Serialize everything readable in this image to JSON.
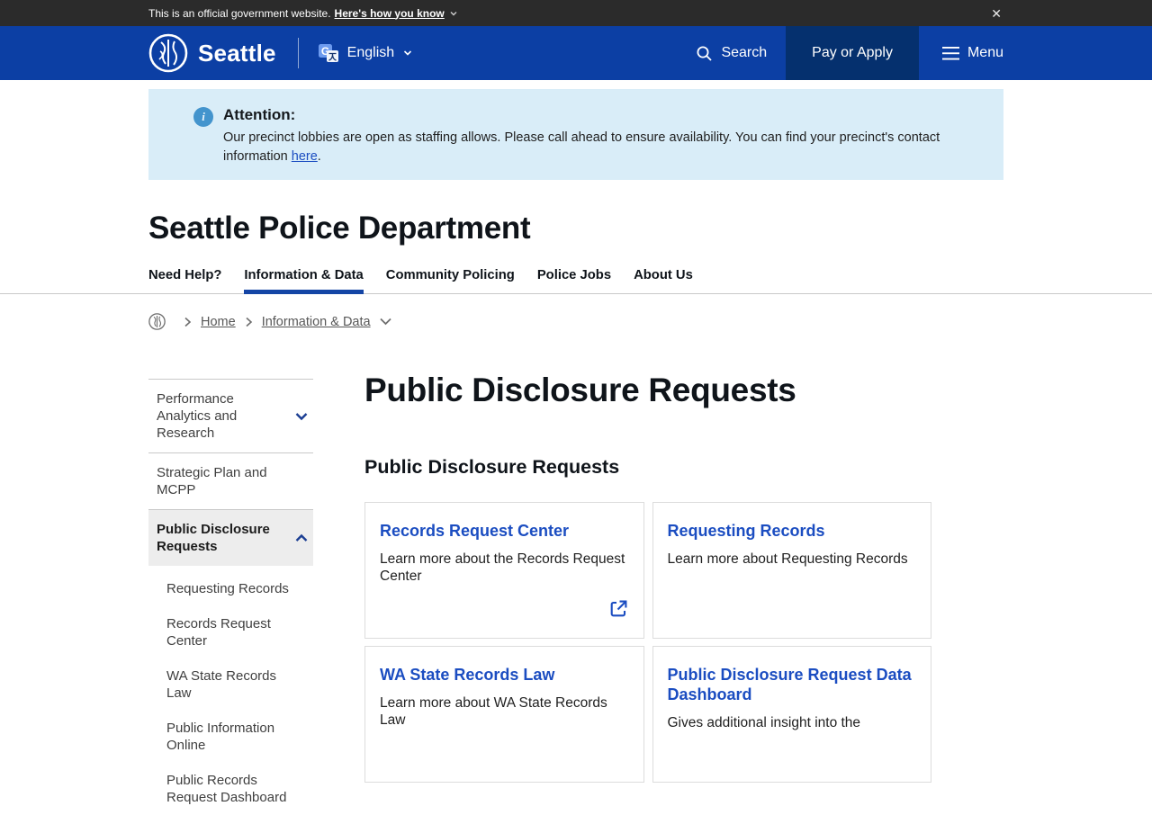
{
  "official_banner": {
    "text": "This is an official government website.",
    "link_text": "Here's how you know",
    "close_label": "✕"
  },
  "header": {
    "brand": "Seattle",
    "language": "English",
    "search_label": "Search",
    "pay_label": "Pay or Apply",
    "menu_label": "Menu",
    "colors": {
      "header_blue": "#0c3fa4",
      "pay_bg": "#05306e"
    }
  },
  "alert": {
    "title": "Attention:",
    "body": "Our precinct lobbies are open as staffing allows. Please call ahead to ensure availability. You can find your precinct's contact information ",
    "link_text": "here",
    "after_link": "."
  },
  "site": {
    "title": "Seattle Police Department"
  },
  "nav": {
    "items": [
      {
        "label": "Need Help?",
        "active": false
      },
      {
        "label": "Information & Data",
        "active": true
      },
      {
        "label": "Community Policing",
        "active": false
      },
      {
        "label": "Police Jobs",
        "active": false
      },
      {
        "label": "About Us",
        "active": false
      }
    ]
  },
  "breadcrumb": {
    "home": "Home",
    "section": "Information & Data"
  },
  "sidebar": {
    "items": [
      {
        "label": "Performance Analytics and Research",
        "chevron": "down"
      },
      {
        "label": "Strategic Plan and MCPP",
        "chevron": "none"
      },
      {
        "label": "Public Disclosure Requests",
        "chevron": "up",
        "active": true
      }
    ],
    "sub": [
      {
        "label": "Requesting Records"
      },
      {
        "label": "Records Request Center"
      },
      {
        "label": "WA State Records Law"
      },
      {
        "label": "Public Information Online"
      },
      {
        "label": "Public Records Request Dashboard"
      }
    ]
  },
  "main": {
    "h1": "Public Disclosure Requests",
    "h2": "Public Disclosure Requests",
    "cards": [
      {
        "title": "Records Request Center",
        "body": "Learn more about the Records Request Center",
        "external": true
      },
      {
        "title": "Requesting Records",
        "body": "Learn more about Requesting Records",
        "external": false
      },
      {
        "title": "WA State Records Law",
        "body": "Learn more about WA State Records Law",
        "external": false
      },
      {
        "title": "Public Disclosure Request Data Dashboard",
        "body": "Gives additional insight into the",
        "external": false
      }
    ]
  },
  "colors": {
    "link_blue": "#1b4dc1",
    "tab_underline": "#1445a5",
    "alert_bg": "#d9edf8",
    "topbar_bg": "#2b2b2b"
  }
}
